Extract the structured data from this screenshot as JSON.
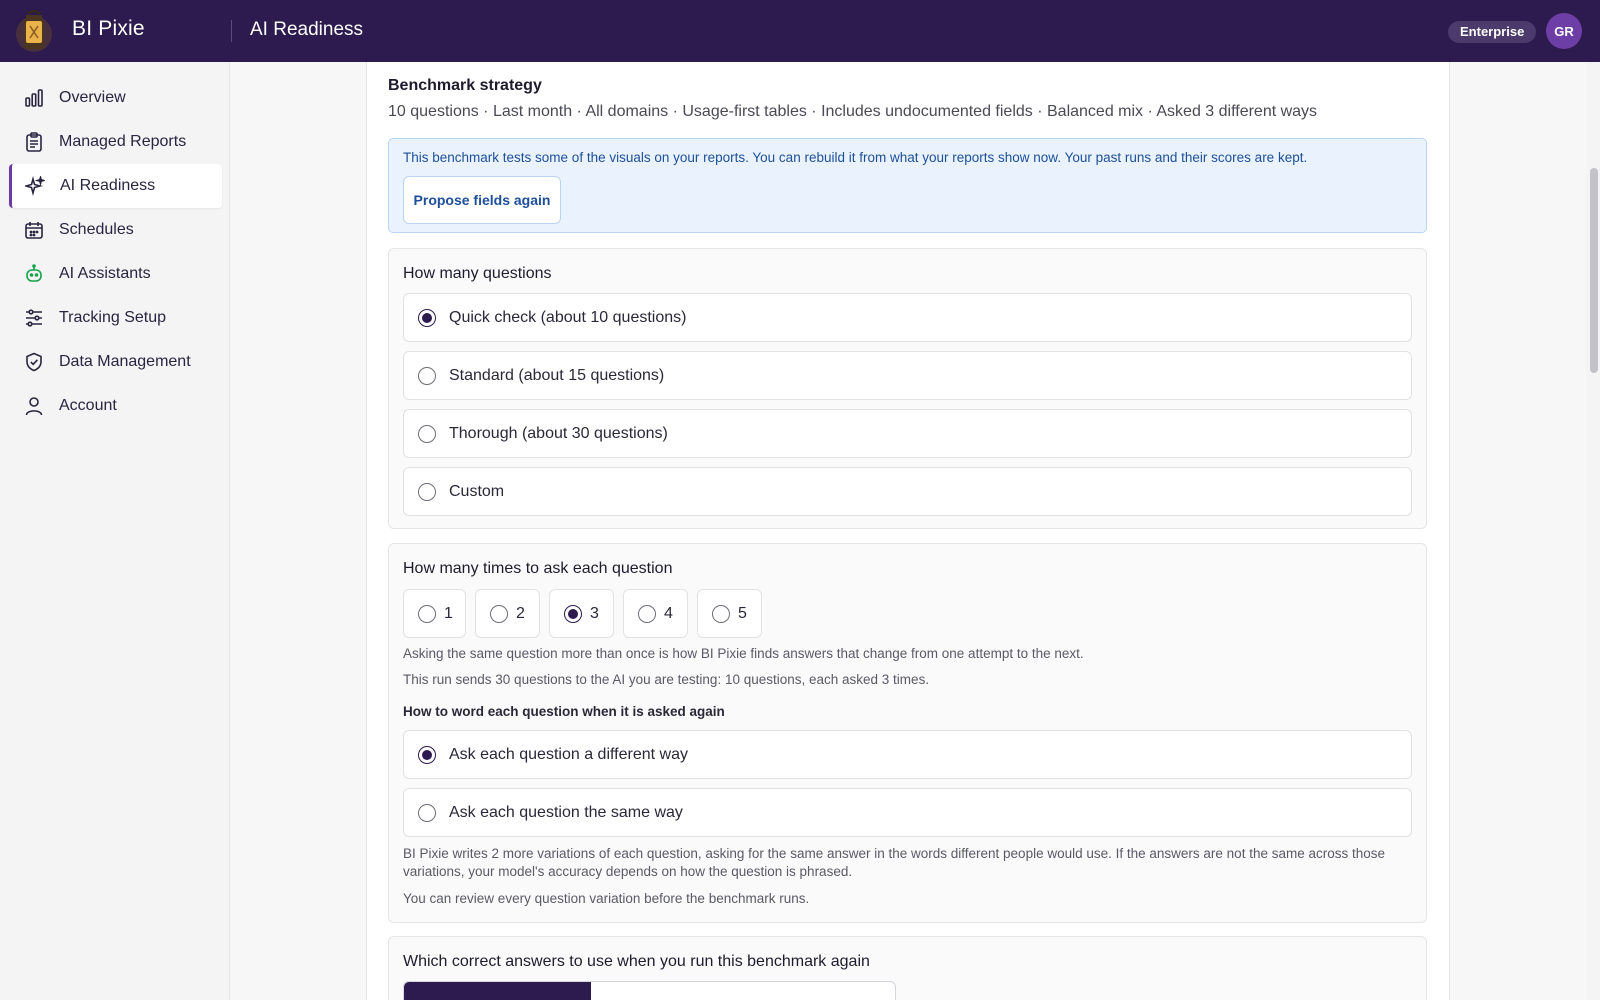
{
  "header": {
    "app_name": "BI Pixie",
    "page_title": "AI Readiness",
    "plan_badge": "Enterprise",
    "avatar_initials": "GR"
  },
  "sidebar": {
    "items": [
      {
        "label": "Overview",
        "icon": "bar-chart-icon"
      },
      {
        "label": "Managed Reports",
        "icon": "clipboard-icon"
      },
      {
        "label": "AI Readiness",
        "icon": "sparkles-icon",
        "active": true
      },
      {
        "label": "Schedules",
        "icon": "calendar-icon"
      },
      {
        "label": "AI Assistants",
        "icon": "robot-icon"
      },
      {
        "label": "Tracking Setup",
        "icon": "sliders-icon"
      },
      {
        "label": "Data Management",
        "icon": "shield-check-icon"
      },
      {
        "label": "Account",
        "icon": "user-icon"
      }
    ]
  },
  "strategy": {
    "title": "Benchmark strategy",
    "summary": "10 questions · Last month · All domains · Usage-first tables · Includes undocumented fields · Balanced mix · Asked 3 different ways"
  },
  "notice": {
    "text": "This benchmark tests some of the visuals on your reports. You can rebuild it from what your reports show now. Your past runs and their scores are kept.",
    "button_label": "Propose fields again"
  },
  "question_count": {
    "title": "How many questions",
    "options": [
      {
        "label": "Quick check (about 10 questions)",
        "checked": true
      },
      {
        "label": "Standard (about 15 questions)",
        "checked": false
      },
      {
        "label": "Thorough (about 30 questions)",
        "checked": false
      },
      {
        "label": "Custom",
        "checked": false
      }
    ]
  },
  "repeat": {
    "title": "How many times to ask each question",
    "options": [
      {
        "label": "1",
        "checked": false
      },
      {
        "label": "2",
        "checked": false
      },
      {
        "label": "3",
        "checked": true
      },
      {
        "label": "4",
        "checked": false
      },
      {
        "label": "5",
        "checked": false
      }
    ],
    "help_1": "Asking the same question more than once is how BI Pixie finds answers that change from one attempt to the next.",
    "help_2": "This run sends 30 questions to the AI you are testing: 10 questions, each asked 3 times.",
    "wording_title": "How to word each question when it is asked again",
    "wording_options": [
      {
        "label": "Ask each question a different way",
        "checked": true
      },
      {
        "label": "Ask each question the same way",
        "checked": false
      }
    ],
    "wording_help_1": "BI Pixie writes 2 more variations of each question, asking for the same answer in the words different people would use. If the answers are not the same across those variations, your model's accuracy depends on how the question is phrased.",
    "wording_help_2": "You can review every question variation before the benchmark runs."
  },
  "answers": {
    "title": "Which correct answers to use when you run this benchmark again"
  },
  "colors": {
    "topbar": "#2d1a4f",
    "accent": "#6a3ba5",
    "notice_bg": "#eaf3fd",
    "notice_text": "#1d4f9b"
  }
}
